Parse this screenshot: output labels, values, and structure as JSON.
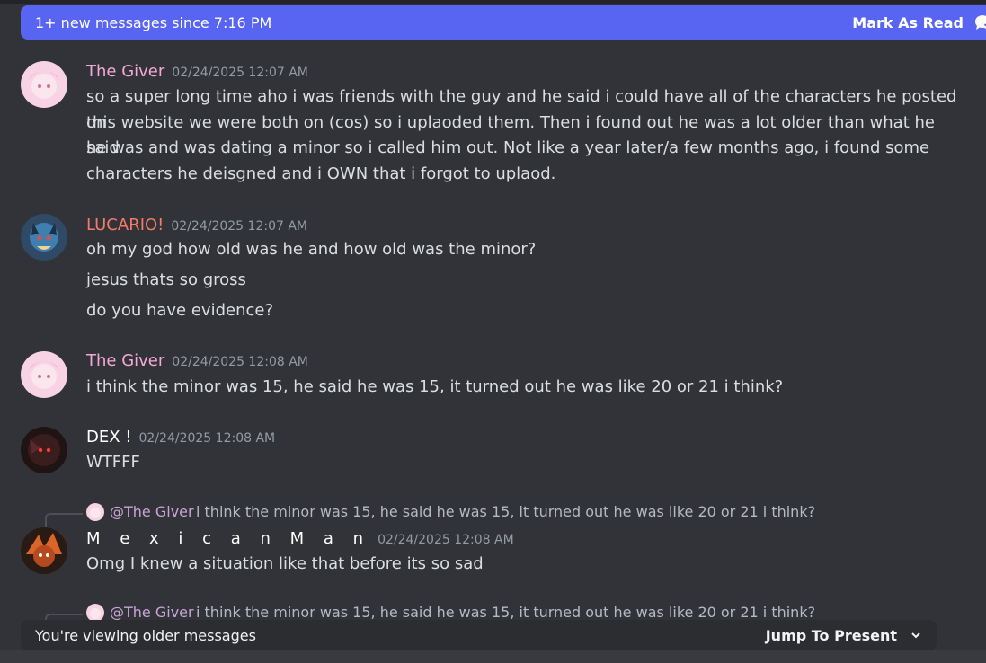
{
  "banner": {
    "text": "1+ new messages since 7:16 PM",
    "mark_read": "Mark As Read",
    "color": "#5865f2"
  },
  "messages": [
    {
      "username": "The Giver",
      "name_color": "#f4a9d4",
      "timestamp": "02/24/2025 12:07 AM",
      "lines": [
        "so a super long time aho i was friends with the guy and he said i could have all of the characters he posted on",
        "this website we were both on (cos) so i uplaoded them. Then i found out he was a lot older than what he said",
        "he was and was dating a minor so i called him out. Not like a year later/a few months ago, i found some",
        "characters he deisgned and i OWN that i forgot to uplaod."
      ]
    },
    {
      "username": "LUCARIO!",
      "name_color": "#f47b67",
      "timestamp": "02/24/2025 12:07 AM",
      "lines": [
        "oh my god how old was he and how old was the minor?",
        "jesus thats so gross",
        "do you have evidence?"
      ]
    },
    {
      "username": "The Giver",
      "name_color": "#f4a9d4",
      "timestamp": "02/24/2025 12:08 AM",
      "lines": [
        "i think the minor was 15, he said he was 15, it turned out he was like 20 or 21 i think?"
      ]
    },
    {
      "username": "DEX !",
      "name_color": "#ffffff",
      "timestamp": "02/24/2025 12:08 AM",
      "lines": [
        "WTFFF"
      ]
    },
    {
      "reply_mention": "@The Giver",
      "reply_text": "i think the minor was 15, he said he was 15, it turned out he was like 20 or 21 i think?",
      "username": "M e x i c a n   M a n",
      "name_color": "#ffffff",
      "timestamp": "02/24/2025 12:08 AM",
      "lines": [
        "Omg I knew a situation like that before its so sad"
      ]
    },
    {
      "reply_mention": "@The Giver",
      "reply_text": "i think the minor was 15, he said he was 15, it turned out he was like 20 or 21 i think?"
    }
  ],
  "older_bar": {
    "label": "You're viewing older messages",
    "jump": "Jump To Present"
  }
}
